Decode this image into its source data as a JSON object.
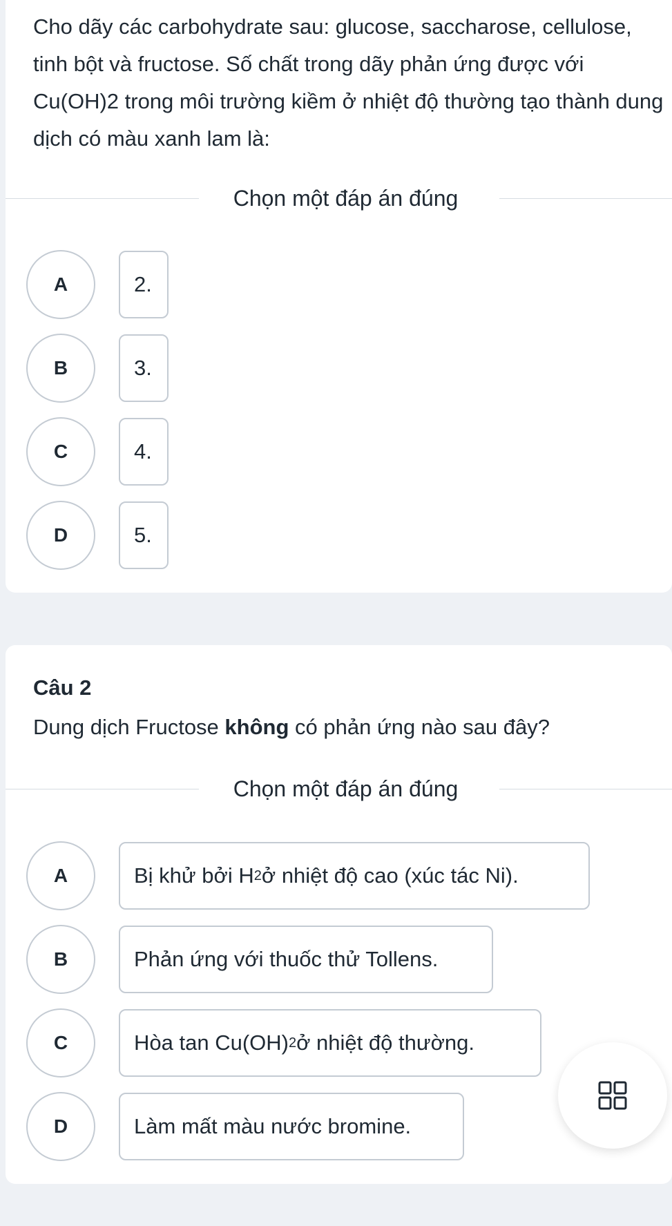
{
  "question1": {
    "text": "Cho dãy các carbohydrate sau: glucose, saccharose, cellulose, tinh bột và fructose. Số chất trong dãy phản ứng được với Cu(OH)2 trong môi trường kiềm ở nhiệt độ thường tạo thành dung dịch có màu xanh lam là:",
    "prompt": "Chọn một đáp án đúng",
    "options": [
      {
        "letter": "A",
        "text": "2."
      },
      {
        "letter": "B",
        "text": "3."
      },
      {
        "letter": "C",
        "text": "4."
      },
      {
        "letter": "D",
        "text": "5."
      }
    ]
  },
  "question2": {
    "number": "Câu 2",
    "text_before": "Dung dịch Fructose ",
    "text_bold": "không",
    "text_after": " có phản ứng nào sau đây?",
    "prompt": "Chọn một đáp án đúng",
    "options": [
      {
        "letter": "A",
        "text_before": "Bị khử bởi H",
        "sub": "2",
        "text_after": " ở nhiệt độ cao (xúc tác Ni)."
      },
      {
        "letter": "B",
        "text_before": "Phản ứng với thuốc thử Tollens.",
        "sub": "",
        "text_after": ""
      },
      {
        "letter": "C",
        "text_before": "Hòa tan Cu(OH)",
        "sub": "2",
        "text_after": " ở nhiệt độ thường."
      },
      {
        "letter": "D",
        "text_before": "Làm mất màu nước bromine.",
        "sub": "",
        "text_after": ""
      }
    ]
  },
  "fab": {
    "icon": "grid-icon"
  },
  "colors": {
    "border": "#c4cbd3",
    "background": "#eef1f5",
    "text": "#1f2933"
  }
}
